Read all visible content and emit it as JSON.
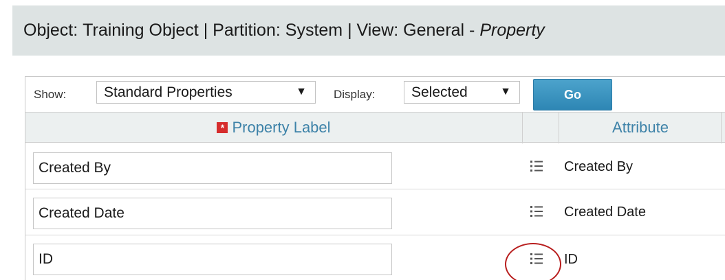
{
  "title_bar": {
    "object_label": "Object:",
    "object_value": "Training Object",
    "partition_label": "Partition:",
    "partition_value": "System",
    "view_label": "View:",
    "view_value": "General",
    "property_partial": "Property"
  },
  "toolbar": {
    "show_label": "Show:",
    "show_value": "Standard Properties",
    "display_label": "Display:",
    "display_value": "Selected",
    "go_label": "Go"
  },
  "table": {
    "headers": {
      "property_label": "Property Label",
      "attribute": "Attribute"
    },
    "rows": [
      {
        "property_label": "Created By",
        "attribute": "Created By"
      },
      {
        "property_label": "Created Date",
        "attribute": "Created Date"
      },
      {
        "property_label": "ID",
        "attribute": "ID"
      }
    ]
  },
  "icons": {
    "required": "required-asterisk-icon",
    "row_action": "list-icon",
    "dropdown": "caret-down-icon"
  },
  "colors": {
    "title_bar_bg": "#dde3e3",
    "header_text": "#3d82a8",
    "go_button": "#3592c2",
    "required_icon": "#d62d2d",
    "highlight_circle": "#b81e1e"
  }
}
